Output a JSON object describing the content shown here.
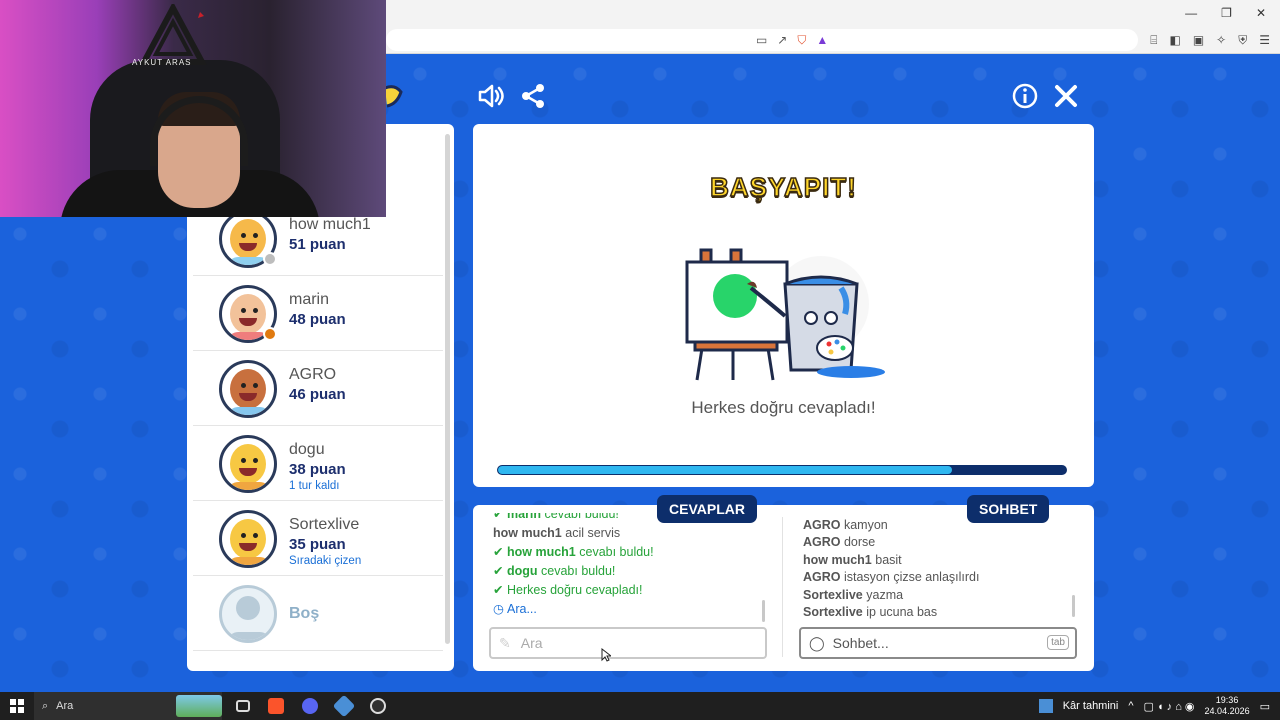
{
  "browser": {
    "window_controls": {
      "minimize": "—",
      "restore": "❐",
      "close": "✕"
    }
  },
  "webcam": {
    "logo_text": "AYKUT ARAS"
  },
  "toolbar": {
    "sound_icon": "speaker-icon",
    "share_icon": "share-icon",
    "info_icon": "info-icon",
    "close_icon": "close-icon"
  },
  "players": [
    {
      "name": "how much1",
      "score": "51 puan",
      "note": "",
      "skin": "#f6b94a",
      "shirt": "#8fd0ef",
      "status": "#bdbdbd"
    },
    {
      "name": "marin",
      "score": "48 puan",
      "note": "",
      "skin": "#f2c29a",
      "shirt": "#ef7d7d",
      "status": "#e07a10"
    },
    {
      "name": "AGRO",
      "score": "46 puan",
      "note": "",
      "skin": "#c8703e",
      "shirt": "#86c7ee",
      "status": ""
    },
    {
      "name": "dogu",
      "score": "38 puan",
      "note": "1 tur kaldı",
      "skin": "#f7c843",
      "shirt": "#f0a640",
      "status": ""
    },
    {
      "name": "Sortexlive",
      "score": "35 puan",
      "note": "Sıradaki çizen",
      "skin": "#f7c843",
      "shirt": "#f0a640",
      "status": ""
    },
    {
      "name": "Boş",
      "score": "",
      "note": "",
      "skin": "#e9f1f6",
      "shirt": "#d7e5ee",
      "status": ""
    }
  ],
  "canvas": {
    "title": "BAŞYAPIT!",
    "message": "Herkes doğru cevapladı!",
    "progress": 0.8
  },
  "answers": {
    "tab_label": "CEVAPLAR",
    "lines": [
      {
        "type": "ok",
        "user": "marin",
        "text": "cevabı buldu!"
      },
      {
        "type": "plain",
        "user": "how much1",
        "text": "acil servis"
      },
      {
        "type": "ok",
        "user": "how much1",
        "text": "cevabı buldu!"
      },
      {
        "type": "ok",
        "user": "dogu",
        "text": "cevabı buldu!"
      },
      {
        "type": "ok",
        "user": "",
        "text": "Herkes doğru cevapladı!"
      },
      {
        "type": "info",
        "user": "",
        "text": "Ara..."
      }
    ],
    "input_placeholder": "Ara"
  },
  "chat": {
    "tab_label": "SOHBET",
    "lines": [
      {
        "user": "AGRO",
        "text": "kamyon"
      },
      {
        "user": "AGRO",
        "text": "dorse"
      },
      {
        "user": "how much1",
        "text": "basit"
      },
      {
        "user": "AGRO",
        "text": "istasyon çizse anlaşılırdı"
      },
      {
        "user": "Sortexlive",
        "text": "yazma"
      },
      {
        "user": "Sortexlive",
        "text": "ip ucuna bas"
      }
    ],
    "input_placeholder": "Sohbet...",
    "tab_key": "tab"
  },
  "taskbar": {
    "search_placeholder": "Ara",
    "weather": "Kâr tahmini",
    "time": "19:36",
    "date": "24.04.2026"
  }
}
